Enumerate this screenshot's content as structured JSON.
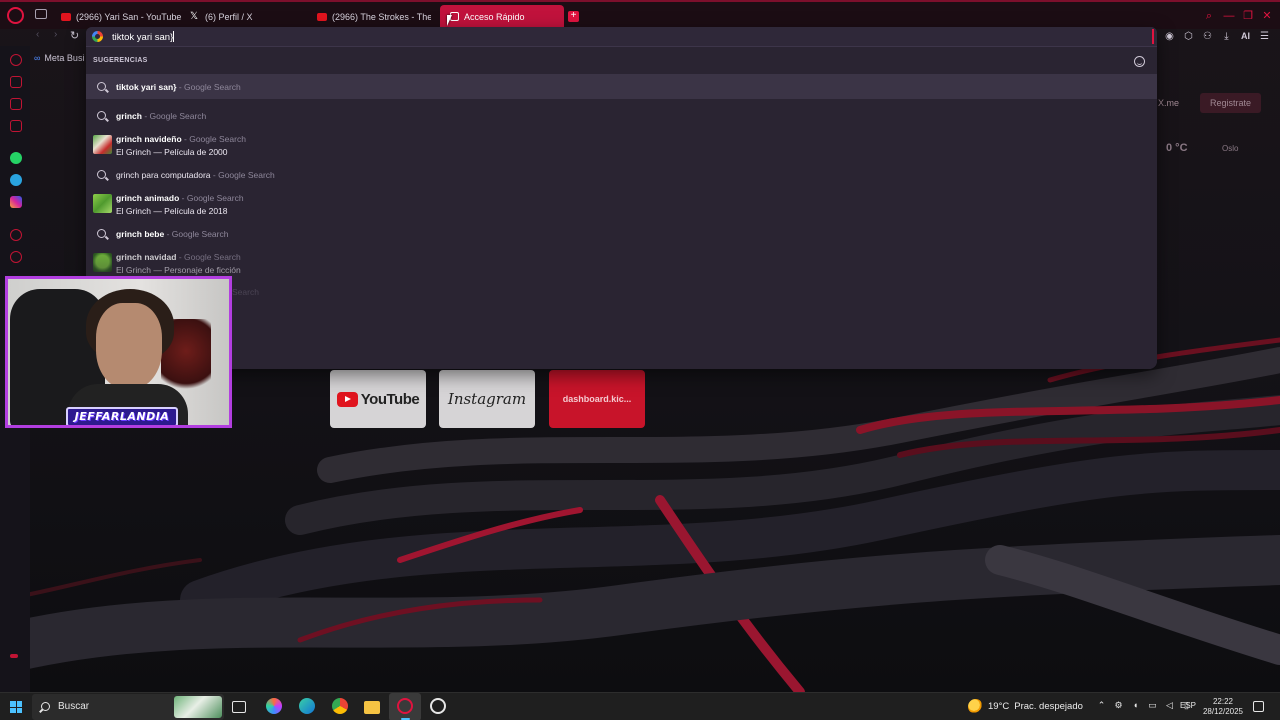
{
  "browser": {
    "tabs": [
      {
        "label": "(2966) Yari San - YouTube",
        "icon": "youtube-icon"
      },
      {
        "label": "(6) Perfil / X",
        "icon": "x-icon"
      },
      {
        "label": "(2966) The Strokes - The",
        "icon": "youtube-icon"
      },
      {
        "label": "Acceso Rápido",
        "icon": "speed-dial-icon",
        "active": true
      }
    ],
    "new_tab": "+",
    "toolbar_ai": "AI",
    "bookmarks_label": "Meta Busi",
    "accent_color": "#e0133f"
  },
  "omnibox": {
    "value": "tiktok yari san}",
    "suggestions_header": "SUGERENCIAS",
    "suggestions": [
      {
        "query": "tiktok yari san}",
        "source": "- Google Search",
        "selected": true
      },
      {
        "query": "grinch",
        "source": "- Google Search"
      },
      {
        "query": "grinch navideño",
        "source": "- Google Search",
        "subtitle": "El Grinch — Película de 2000",
        "has_thumb": true
      },
      {
        "query": "grinch para computadora",
        "source": "- Google Search"
      },
      {
        "query": "grinch animado",
        "source": "- Google Search",
        "subtitle": "El Grinch — Película de 2018",
        "has_thumb": true
      },
      {
        "query": "grinch bebe",
        "source": "- Google Search"
      },
      {
        "query": "grinch navidad",
        "source": "- Google Search",
        "subtitle": "El Grinch — Personaje de ficción",
        "has_thumb": true
      },
      {
        "query": "",
        "source": "Search"
      }
    ],
    "partial_bottom_text": "h"
  },
  "speed_dials": [
    {
      "label": "YouTube"
    },
    {
      "label": "Instagram"
    },
    {
      "label": "dashboard.kic..."
    }
  ],
  "widgets": {
    "x_me": "X.me",
    "register": "Registrate",
    "temperature": "0 °C",
    "city": "Oslo"
  },
  "webcam": {
    "banner": "JEFFARLANDIA"
  },
  "taskbar": {
    "search_placeholder": "Buscar",
    "weather_temp": "19°C",
    "weather_desc": "Prac. despejado",
    "language": "ESP",
    "time": "22:22",
    "date": "28/12/2025"
  }
}
